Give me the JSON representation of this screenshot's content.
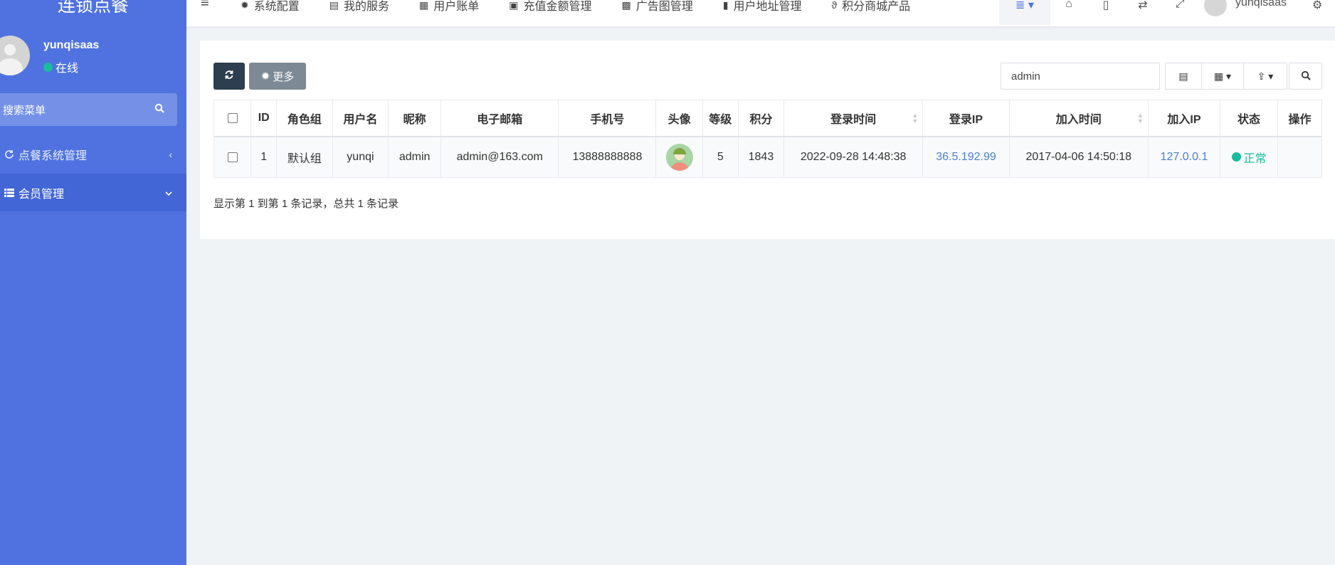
{
  "sidebar": {
    "brand": "连锁点餐",
    "user": {
      "name": "yunqisaas",
      "status": "在线"
    },
    "search_placeholder": "搜索菜单",
    "menu": [
      {
        "label": "点餐系统管理",
        "arrow": "‹"
      },
      {
        "label": "会员管理",
        "arrow": "⌄"
      }
    ]
  },
  "topnav": {
    "tabs": [
      {
        "icon": "gear-icon",
        "label": "系统配置"
      },
      {
        "icon": "server-icon",
        "label": "我的服务"
      },
      {
        "icon": "list-alt-icon",
        "label": "用户账单"
      },
      {
        "icon": "money-icon",
        "label": "充值金额管理"
      },
      {
        "icon": "font-icon",
        "label": "广告图管理"
      },
      {
        "icon": "address-book-icon",
        "label": "用户地址管理"
      },
      {
        "icon": "stethoscope-icon",
        "label": "积分商城产品"
      }
    ],
    "user_name": "yunqisaas"
  },
  "toolbar": {
    "more_label": "更多",
    "search_value": "admin"
  },
  "table": {
    "columns": [
      "ID",
      "角色组",
      "用户名",
      "昵称",
      "电子邮箱",
      "手机号",
      "头像",
      "等级",
      "积分",
      "登录时间",
      "登录IP",
      "加入时间",
      "加入IP",
      "状态",
      "操作"
    ],
    "rows": [
      {
        "id": "1",
        "group": "默认组",
        "username": "yunqi",
        "nickname": "admin",
        "email": "admin@163.com",
        "mobile": "13888888888",
        "level": "5",
        "score": "1843",
        "logintime": "2022-09-28 14:48:38",
        "loginip": "36.5.192.99",
        "jointime": "2017-04-06 14:50:18",
        "joinip": "127.0.0.1",
        "status": "正常"
      }
    ]
  },
  "pagination_info": "显示第 1 到第 1 条记录，总共 1 条记录",
  "colors": {
    "sidebar": "#4f72e0",
    "accent_green": "#18bc9c",
    "link_blue": "#4a7fd0",
    "dark_button": "#2c3e50"
  }
}
